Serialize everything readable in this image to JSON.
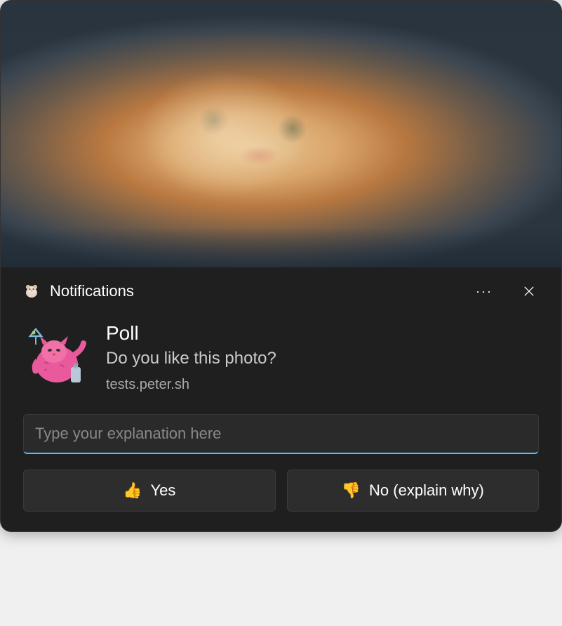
{
  "header": {
    "app_name": "Notifications",
    "more_label": "···"
  },
  "content": {
    "title": "Poll",
    "message": "Do you like this photo?",
    "source": "tests.peter.sh"
  },
  "input": {
    "placeholder": "Type your explanation here",
    "value": ""
  },
  "buttons": {
    "yes": {
      "emoji": "👍",
      "label": "Yes"
    },
    "no": {
      "emoji": "👎",
      "label": "No (explain why)"
    }
  }
}
